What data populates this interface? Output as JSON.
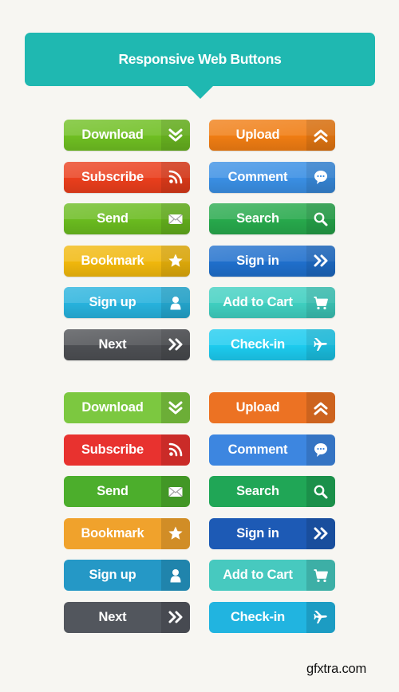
{
  "header": {
    "title": "Responsive Web Buttons"
  },
  "sets": [
    {
      "style": "glossy",
      "buttons": [
        {
          "label": "Download",
          "icon": "double-chevron-down-icon",
          "color": "#6fbf22"
        },
        {
          "label": "Upload",
          "icon": "double-chevron-up-icon",
          "color": "#f07d13"
        },
        {
          "label": "Subscribe",
          "icon": "rss-icon",
          "color": "#ea3e1c"
        },
        {
          "label": "Comment",
          "icon": "speech-bubble-icon",
          "color": "#3a8fe4"
        },
        {
          "label": "Send",
          "icon": "envelope-icon",
          "color": "#6abb1f"
        },
        {
          "label": "Search",
          "icon": "magnifier-icon",
          "color": "#27a94c"
        },
        {
          "label": "Bookmark",
          "icon": "star-icon",
          "color": "#f1b80c"
        },
        {
          "label": "Sign in",
          "icon": "double-chevron-right-icon",
          "color": "#1f6fcc"
        },
        {
          "label": "Sign up",
          "icon": "user-icon",
          "color": "#27b2dd"
        },
        {
          "label": "Add to Cart",
          "icon": "cart-icon",
          "color": "#3fcfc0"
        },
        {
          "label": "Next",
          "icon": "double-chevron-right-icon",
          "color": "#4d4f53"
        },
        {
          "label": "Check-in",
          "icon": "airplane-icon",
          "color": "#1ccbef"
        }
      ]
    },
    {
      "style": "flat",
      "buttons": [
        {
          "label": "Download",
          "icon": "double-chevron-down-icon",
          "color": "#7cc840"
        },
        {
          "label": "Upload",
          "icon": "double-chevron-up-icon",
          "color": "#ec7223"
        },
        {
          "label": "Subscribe",
          "icon": "rss-icon",
          "color": "#e8322f"
        },
        {
          "label": "Comment",
          "icon": "speech-bubble-icon",
          "color": "#3d86e0"
        },
        {
          "label": "Send",
          "icon": "envelope-icon",
          "color": "#4cae2c"
        },
        {
          "label": "Search",
          "icon": "magnifier-icon",
          "color": "#20a656"
        },
        {
          "label": "Bookmark",
          "icon": "star-icon",
          "color": "#f0a22c"
        },
        {
          "label": "Sign in",
          "icon": "double-chevron-right-icon",
          "color": "#1d5ab5"
        },
        {
          "label": "Sign up",
          "icon": "user-icon",
          "color": "#2598c6"
        },
        {
          "label": "Add to Cart",
          "icon": "cart-icon",
          "color": "#47c9bf"
        },
        {
          "label": "Next",
          "icon": "double-chevron-right-icon",
          "color": "#52565d"
        },
        {
          "label": "Check-in",
          "icon": "airplane-icon",
          "color": "#21b4e0"
        }
      ]
    }
  ],
  "watermark": "gfxtra.com"
}
